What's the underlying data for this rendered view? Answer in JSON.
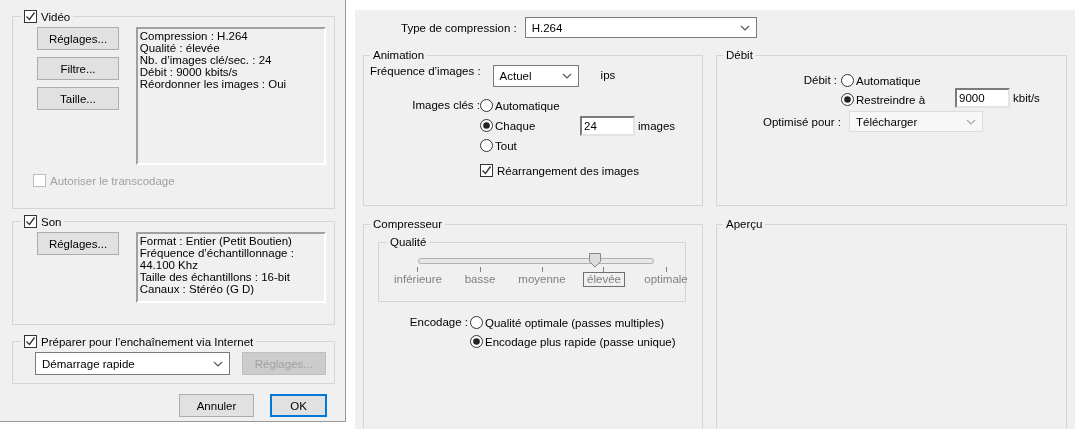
{
  "export_dialog": {
    "video": {
      "label": "Vidéo",
      "checked": true,
      "buttons": [
        "Réglages...",
        "Filtre...",
        "Taille..."
      ],
      "summary": [
        "Compression : H.264",
        "Qualité : élevée",
        "Nb. d’images clé/sec. :  24",
        "Débit : 9000 kbits/s",
        "Réordonner les images : Oui"
      ],
      "transcode": {
        "label": "Autoriser le transcodage",
        "checked": false,
        "disabled": true
      }
    },
    "sound": {
      "label": "Son",
      "checked": true,
      "buttons": [
        "Réglages..."
      ],
      "summary": [
        "Format : Entier (Petit Boutien)",
        "Fréquence d’échantillonnage : 44.100 Khz",
        "Taille des échantillons : 16-bit",
        "Canaux : Stéréo (G D)"
      ]
    },
    "streaming": {
      "label": "Préparer pour l’enchaînement via Internet",
      "checked": true,
      "dropdown": "Démarrage rapide",
      "settings_button": {
        "label": "Réglages...",
        "disabled": true
      }
    },
    "buttons": [
      {
        "label": "Annuler",
        "default": false
      },
      {
        "label": "OK",
        "default": true
      }
    ]
  },
  "compression_settings": {
    "compression_type": {
      "label": "Type de compression :",
      "value": "H.264"
    },
    "animation": {
      "title": "Animation",
      "frame_rate": {
        "label": "Fréquence d’images :",
        "value": "Actuel",
        "unit": "ips"
      },
      "keyframes": {
        "label": "Images clés :",
        "options": [
          {
            "label": "Automatique",
            "selected": false
          },
          {
            "label": "Chaque",
            "selected": true
          },
          {
            "label": "Tout",
            "selected": false
          }
        ],
        "value": "24",
        "unit": "images"
      },
      "reorder": {
        "label": "Réarrangement des images",
        "checked": true
      }
    },
    "bitrate": {
      "title": "Débit",
      "label": "Débit :",
      "options": [
        {
          "label": "Automatique",
          "selected": false
        },
        {
          "label": "Restreindre à",
          "selected": true
        }
      ],
      "value": "9000",
      "unit": "kbit/s",
      "optimized_for": {
        "label": "Optimisé pour :",
        "value": "Télécharger"
      }
    },
    "compressor": {
      "title": "Compresseur",
      "quality": {
        "title": "Qualité",
        "level": 0.75,
        "ticks": [
          {
            "label": "inférieure",
            "selected": false
          },
          {
            "label": "basse",
            "selected": false
          },
          {
            "label": "moyenne",
            "selected": false
          },
          {
            "label": "élevée",
            "selected": true
          },
          {
            "label": "optimale",
            "selected": false
          }
        ]
      },
      "encoding": {
        "label": "Encodage :",
        "options": [
          {
            "label": "Qualité optimale (passes multiples)",
            "selected": false
          },
          {
            "label": "Encodage plus rapide (passe unique)",
            "selected": true
          }
        ]
      }
    },
    "preview": {
      "title": "Aperçu"
    }
  }
}
